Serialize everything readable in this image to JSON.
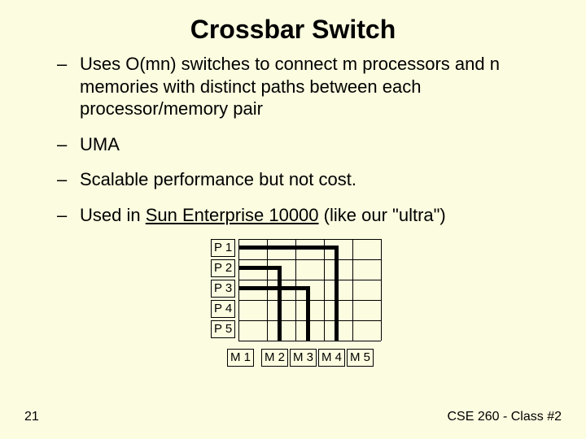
{
  "title": "Crossbar Switch",
  "bullets": [
    "Uses O(mn) switches to connect m processors and n memories with distinct paths between each processor/memory pair",
    "UMA",
    "Scalable performance but not cost.",
    "Used in <span class=\"underline\">Sun Enterprise 10000</span> (like our \"ultra\")"
  ],
  "diagram": {
    "processors": [
      "P 1",
      "P 2",
      "P 3",
      "P 4",
      "P 5"
    ],
    "memories": [
      "M 1",
      "M 2",
      "M 3",
      "M 4",
      "M 5"
    ]
  },
  "footer": {
    "page": "21",
    "course": "CSE 260 - Class #2"
  }
}
